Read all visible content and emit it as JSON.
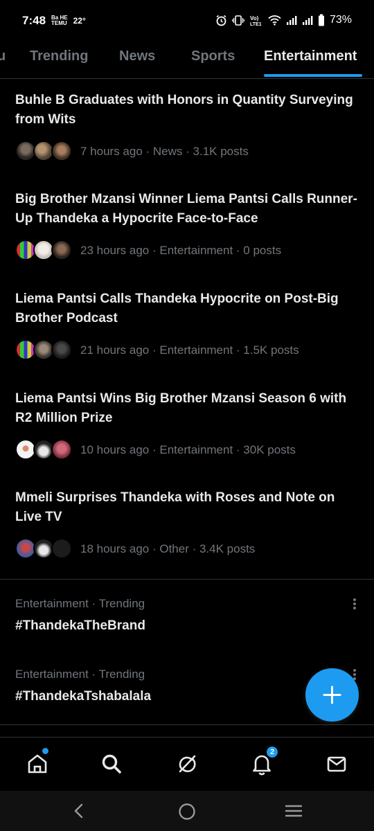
{
  "status_bar": {
    "time": "7:48",
    "small_label_top": "Ba HE",
    "small_label_bottom": "TEMU",
    "temperature": "22°",
    "battery": "73%",
    "icons": [
      "alarm-icon",
      "vibrate-icon",
      "volte-icon",
      "wifi-icon",
      "signal-icon",
      "signal-icon",
      "battery-icon"
    ]
  },
  "tabs": [
    {
      "label": "u",
      "active": false
    },
    {
      "label": "Trending",
      "active": false
    },
    {
      "label": "News",
      "active": false
    },
    {
      "label": "Sports",
      "active": false
    },
    {
      "label": "Entertainment",
      "active": true
    }
  ],
  "stories": [
    {
      "title": "Buhle B Graduates with Honors in Quantity Surveying from Wits",
      "meta": "7 hours ago · News · 3.1K posts"
    },
    {
      "title": "Big Brother Mzansi Winner Liema Pantsi Calls Runner-Up Thandeka a Hypocrite Face-to-Face",
      "meta": "23 hours ago · Entertainment · 0 posts"
    },
    {
      "title": "Liema Pantsi Calls Thandeka Hypocrite on Post-Big Brother Podcast",
      "meta": "21 hours ago · Entertainment · 1.5K posts"
    },
    {
      "title": "Liema Pantsi Wins Big Brother Mzansi Season 6 with R2 Million Prize",
      "meta": "10 hours ago · Entertainment · 30K posts"
    },
    {
      "title": "Mmeli Surprises Thandeka with Roses and Note on Live TV",
      "meta": "18 hours ago · Other · 3.4K posts"
    }
  ],
  "trends": [
    {
      "category": "Entertainment · Trending",
      "tag": "#ThandekaTheBrand"
    },
    {
      "category": "Entertainment · Trending",
      "tag": "#ThandekaTshabalala"
    }
  ],
  "bottom_nav": {
    "items": [
      "home-icon",
      "search-icon",
      "grok-icon",
      "notifications-icon",
      "messages-icon"
    ],
    "notifications_badge": "2"
  },
  "colors": {
    "accent": "#1d9bf0",
    "text": "#e7e9ea",
    "muted": "#71767b",
    "background": "#000000",
    "divider": "#2f3336"
  }
}
